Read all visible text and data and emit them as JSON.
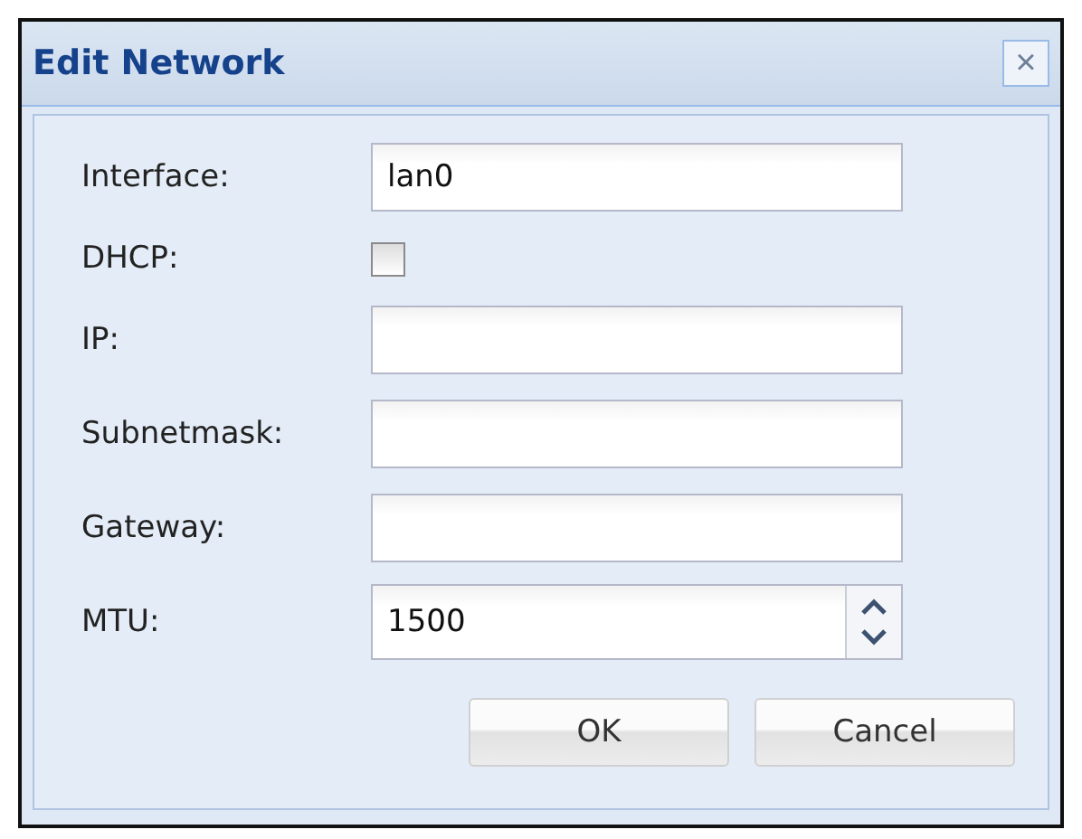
{
  "window": {
    "title": "Edit Network",
    "close": "×"
  },
  "fields": [
    {
      "label": "Interface:",
      "kind": "text",
      "value": "lan0"
    },
    {
      "label": "DHCP:",
      "kind": "checkbox",
      "checked": false
    },
    {
      "label": "IP:",
      "kind": "text"
    },
    {
      "label": "Subnetmask:",
      "kind": "text"
    },
    {
      "label": "Gateway:",
      "kind": "text"
    },
    {
      "label": "MTU:",
      "kind": "spinner",
      "value": "1500"
    }
  ],
  "buttons": [
    "OK",
    "Cancel"
  ]
}
